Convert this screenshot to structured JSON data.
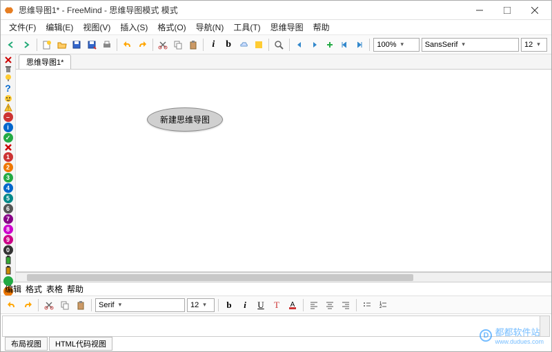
{
  "window": {
    "title": "思维导图1* - FreeMind - 思维导图模式 模式"
  },
  "menu": {
    "file": "文件(F)",
    "edit": "编辑(E)",
    "view": "视图(V)",
    "insert": "插入(S)",
    "format": "格式(O)",
    "navigate": "导航(N)",
    "tools": "工具(T)",
    "mindmap": "思维导图",
    "help": "帮助"
  },
  "toolbar": {
    "zoom": "100%",
    "font": "SansSerif",
    "size": "12"
  },
  "tab": {
    "label": "思维导图1*"
  },
  "node": {
    "text": "新建思维导图"
  },
  "bottom": {
    "menu": {
      "edit": "编辑",
      "format": "格式",
      "table": "表格",
      "help": "帮助"
    },
    "font": "Serif",
    "size": "12",
    "tab1": "布局视图",
    "tab2": "HTML代码视图"
  },
  "watermark": {
    "text": "都都软件站",
    "url": "www.dudues.com"
  }
}
